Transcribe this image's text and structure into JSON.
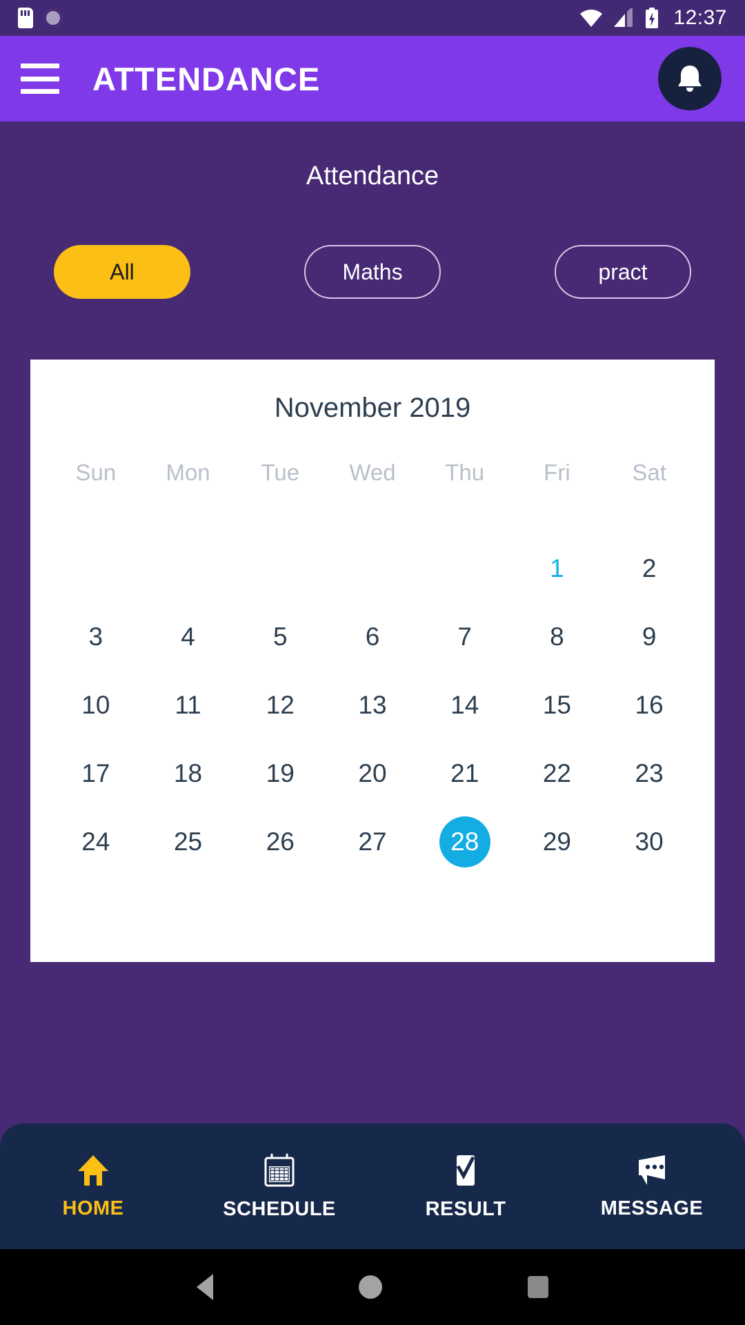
{
  "statusbar": {
    "time": "12:37",
    "icons": [
      "sd-card-icon",
      "sync-icon",
      "wifi-icon",
      "cellular-signal-icon",
      "battery-charging-icon"
    ]
  },
  "appbar": {
    "menu_icon": "hamburger-menu-icon",
    "title": "ATTENDANCE",
    "notification_icon": "bell-icon",
    "background": "#8039E8"
  },
  "page": {
    "title": "Attendance",
    "background": "#472974"
  },
  "filters": {
    "chips": [
      {
        "label": "All",
        "selected": true
      },
      {
        "label": "Maths",
        "selected": false
      },
      {
        "label": "pract",
        "selected": false
      }
    ],
    "selected_color": "#FBBF16"
  },
  "calendar": {
    "month_label": "November 2019",
    "weekdays": [
      "Sun",
      "Mon",
      "Tue",
      "Wed",
      "Thu",
      "Fri",
      "Sat"
    ],
    "leading_blanks": 5,
    "days": [
      {
        "n": "1",
        "state": "marked"
      },
      {
        "n": "2",
        "state": "normal"
      },
      {
        "n": "3",
        "state": "normal"
      },
      {
        "n": "4",
        "state": "normal"
      },
      {
        "n": "5",
        "state": "normal"
      },
      {
        "n": "6",
        "state": "normal"
      },
      {
        "n": "7",
        "state": "normal"
      },
      {
        "n": "8",
        "state": "normal"
      },
      {
        "n": "9",
        "state": "normal"
      },
      {
        "n": "10",
        "state": "normal"
      },
      {
        "n": "11",
        "state": "normal"
      },
      {
        "n": "12",
        "state": "normal"
      },
      {
        "n": "13",
        "state": "normal"
      },
      {
        "n": "14",
        "state": "normal"
      },
      {
        "n": "15",
        "state": "normal"
      },
      {
        "n": "16",
        "state": "normal"
      },
      {
        "n": "17",
        "state": "normal"
      },
      {
        "n": "18",
        "state": "normal"
      },
      {
        "n": "19",
        "state": "normal"
      },
      {
        "n": "20",
        "state": "normal"
      },
      {
        "n": "21",
        "state": "normal"
      },
      {
        "n": "22",
        "state": "normal"
      },
      {
        "n": "23",
        "state": "normal"
      },
      {
        "n": "24",
        "state": "normal"
      },
      {
        "n": "25",
        "state": "normal"
      },
      {
        "n": "26",
        "state": "normal"
      },
      {
        "n": "27",
        "state": "normal"
      },
      {
        "n": "28",
        "state": "today"
      },
      {
        "n": "29",
        "state": "normal"
      },
      {
        "n": "30",
        "state": "normal"
      }
    ],
    "marked_color": "#0FAEE8",
    "today_color": "#13ADE4",
    "text_color": "#2d3e4f",
    "weekday_color": "#b9bfc9"
  },
  "bottomnav": {
    "background": "#16294A",
    "active_color": "#FBBF16",
    "items": [
      {
        "label": "HOME",
        "icon": "home-icon",
        "active": true
      },
      {
        "label": "SCHEDULE",
        "icon": "calendar-icon",
        "active": false
      },
      {
        "label": "RESULT",
        "icon": "checklist-icon",
        "active": false
      },
      {
        "label": "MESSAGE",
        "icon": "message-icon",
        "active": false
      }
    ]
  },
  "androidnav": {
    "back": "back-triangle-icon",
    "home": "home-circle-icon",
    "recents": "recents-square-icon"
  }
}
